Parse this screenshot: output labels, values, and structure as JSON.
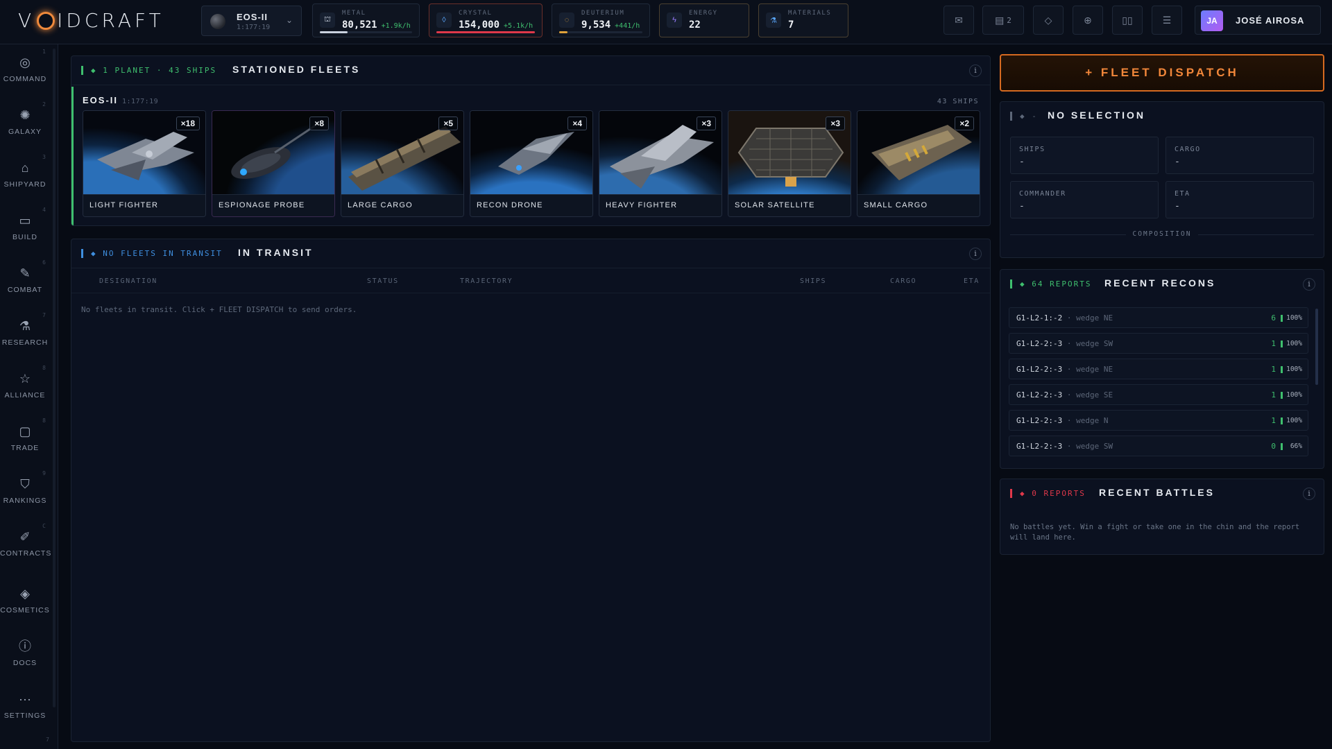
{
  "app": {
    "logo_text_left": "V",
    "logo_text_right": "IDCRAFT"
  },
  "planet_selector": {
    "name": "EOS-II",
    "coords": "1:177:19"
  },
  "resources": [
    {
      "label": "METAL",
      "value": "80,521",
      "rate": "+1.9k/h",
      "icon": "metal-icon",
      "fill_fraction": 0.3,
      "color": "#c9d1de"
    },
    {
      "label": "CRYSTAL",
      "value": "154,000",
      "rate": "+5.1k/h",
      "icon": "crystal-icon",
      "fill_fraction": 1.0,
      "color": "#e0384a"
    },
    {
      "label": "DEUTERIUM",
      "value": "9,534",
      "rate": "+441/h",
      "icon": "deuterium-icon",
      "fill_fraction": 0.1,
      "color": "#e0a23a"
    },
    {
      "label": "ENERGY",
      "value": "22",
      "icon": "energy-icon"
    },
    {
      "label": "MATERIALS",
      "value": "7",
      "icon": "materials-icon"
    }
  ],
  "topbar_buttons": {
    "tasks_count": "2"
  },
  "user": {
    "initials": "JA",
    "name": "JOSÉ AIROSA"
  },
  "sidebar": {
    "items": [
      {
        "key": "1",
        "label": "COMMAND",
        "icon": "command-icon"
      },
      {
        "key": "2",
        "label": "GALAXY",
        "icon": "galaxy-icon"
      },
      {
        "key": "3",
        "label": "SHIPYARD",
        "icon": "shipyard-icon"
      },
      {
        "key": "4",
        "label": "BUILD",
        "icon": "build-icon"
      },
      {
        "key": "6",
        "label": "COMBAT",
        "icon": "combat-icon"
      },
      {
        "key": "7",
        "label": "RESEARCH",
        "icon": "research-icon"
      },
      {
        "key": "8",
        "label": "ALLIANCE",
        "icon": "alliance-icon"
      },
      {
        "key": "8",
        "label": "TRADE",
        "icon": "trade-icon"
      },
      {
        "key": "9",
        "label": "RANKINGS",
        "icon": "rankings-icon"
      },
      {
        "key": "C",
        "label": "CONTRACTS",
        "icon": "contracts-icon"
      },
      {
        "key": "",
        "label": "COSMETICS",
        "icon": "cosmetics-icon"
      },
      {
        "key": "",
        "label": "DOCS",
        "icon": "docs-icon"
      },
      {
        "key": "",
        "label": "SETTINGS",
        "icon": "settings-icon"
      }
    ],
    "bottom_key": "7"
  },
  "stationed": {
    "tag": "◆ 1 PLANET · 43 SHIPS",
    "title": "STATIONED FLEETS",
    "location_name": "EOS-II",
    "location_coords": "1:177:19",
    "location_ships": "43 SHIPS",
    "ships": [
      {
        "name": "LIGHT FIGHTER",
        "count": "×18"
      },
      {
        "name": "ESPIONAGE PROBE",
        "count": "×8"
      },
      {
        "name": "LARGE CARGO",
        "count": "×5"
      },
      {
        "name": "RECON DRONE",
        "count": "×4"
      },
      {
        "name": "HEAVY FIGHTER",
        "count": "×3"
      },
      {
        "name": "SOLAR SATELLITE",
        "count": "×3"
      },
      {
        "name": "SMALL CARGO",
        "count": "×2"
      }
    ]
  },
  "transit": {
    "tag": "◆ NO FLEETS IN TRANSIT",
    "title": "IN TRANSIT",
    "columns": [
      "DESIGNATION",
      "STATUS",
      "TRAJECTORY",
      "SHIPS",
      "CARGO",
      "ETA"
    ],
    "empty_message": "No fleets in transit. Click + FLEET DISPATCH to send orders."
  },
  "dispatch": {
    "label": "+ FLEET DISPATCH"
  },
  "selection": {
    "tag": "◆ -",
    "title": "NO SELECTION",
    "cells": [
      {
        "label": "SHIPS",
        "value": "-"
      },
      {
        "label": "CARGO",
        "value": "-"
      },
      {
        "label": "COMMANDER",
        "value": "-"
      },
      {
        "label": "ETA",
        "value": "-"
      }
    ],
    "composition_label": "COMPOSITION"
  },
  "recons": {
    "tag": "◆ 64 REPORTS",
    "title": "RECENT RECONS",
    "rows": [
      {
        "coords": "G1-L2-1:-2",
        "dir": "· wedge NE",
        "count": "6",
        "pct": "100%"
      },
      {
        "coords": "G1-L2-2:-3",
        "dir": "· wedge SW",
        "count": "1",
        "pct": "100%"
      },
      {
        "coords": "G1-L2-2:-3",
        "dir": "· wedge NE",
        "count": "1",
        "pct": "100%"
      },
      {
        "coords": "G1-L2-2:-3",
        "dir": "· wedge SE",
        "count": "1",
        "pct": "100%"
      },
      {
        "coords": "G1-L2-2:-3",
        "dir": "· wedge N",
        "count": "1",
        "pct": "100%"
      },
      {
        "coords": "G1-L2-2:-3",
        "dir": "· wedge SW",
        "count": "0",
        "pct": "66%"
      }
    ]
  },
  "battles": {
    "tag": "◆ 0 REPORTS",
    "title": "RECENT BATTLES",
    "message": "No battles yet. Win a fight or take one in the chin and the report will land here."
  },
  "colors": {
    "accent": "#f08a3c",
    "green": "#3fbf6e",
    "blue": "#3f8fe0",
    "red": "#e0384a"
  }
}
